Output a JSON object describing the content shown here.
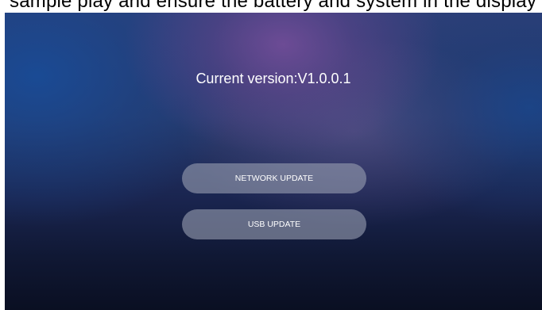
{
  "header": {
    "partial_text": "sample play and ensure the battery and system in the display"
  },
  "main": {
    "version_text": "Current version:V1.0.0.1",
    "buttons": [
      {
        "label": "NETWORK UPDATE"
      },
      {
        "label": "USB UPDATE"
      }
    ]
  },
  "colors": {
    "background_top": "#2c3f78",
    "background_bottom": "#0a0f22",
    "glow_purple": "#784e9b",
    "glow_blue": "#194b96",
    "button_fill": "#969cb0",
    "text": "#ffffff"
  }
}
